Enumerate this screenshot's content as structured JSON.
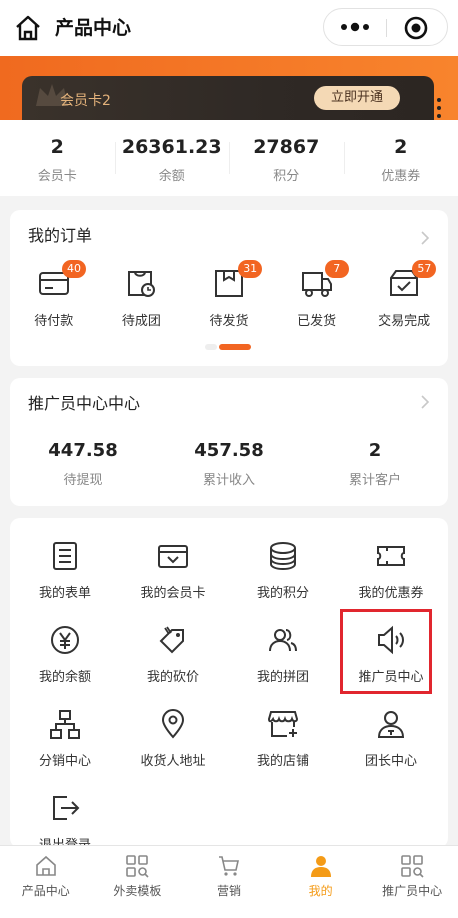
{
  "header": {
    "title": "产品中心"
  },
  "vip": {
    "label": "会员卡2",
    "button": "立即开通"
  },
  "stats": [
    {
      "value": "2",
      "label": "会员卡"
    },
    {
      "value": "26361.23",
      "label": "余额"
    },
    {
      "value": "27867",
      "label": "积分"
    },
    {
      "value": "2",
      "label": "优惠券"
    }
  ],
  "orders": {
    "title": "我的订单",
    "items": [
      {
        "label": "待付款",
        "badge": "40",
        "icon": "wallet-icon"
      },
      {
        "label": "待成团",
        "badge": "",
        "icon": "group-clock-icon"
      },
      {
        "label": "待发货",
        "badge": "31",
        "icon": "box-icon"
      },
      {
        "label": "已发货",
        "badge": "7",
        "icon": "truck-icon"
      },
      {
        "label": "交易完成",
        "badge": "57",
        "icon": "check-box-icon"
      }
    ]
  },
  "promoter": {
    "title": "推广员中心中心",
    "items": [
      {
        "value": "447.58",
        "label": "待提现"
      },
      {
        "value": "457.58",
        "label": "累计收入"
      },
      {
        "value": "2",
        "label": "累计客户"
      }
    ]
  },
  "tools": [
    {
      "label": "我的表单",
      "icon": "form-icon"
    },
    {
      "label": "我的会员卡",
      "icon": "member-card-icon"
    },
    {
      "label": "我的积分",
      "icon": "points-icon"
    },
    {
      "label": "我的优惠券",
      "icon": "coupon-icon"
    },
    {
      "label": "我的余额",
      "icon": "yen-icon"
    },
    {
      "label": "我的砍价",
      "icon": "bargain-tag-icon"
    },
    {
      "label": "我的拼团",
      "icon": "group-icon"
    },
    {
      "label": "推广员中心",
      "icon": "speaker-icon"
    },
    {
      "label": "分销中心",
      "icon": "hierarchy-icon"
    },
    {
      "label": "收货人地址",
      "icon": "location-icon"
    },
    {
      "label": "我的店铺",
      "icon": "store-icon"
    },
    {
      "label": "团长中心",
      "icon": "leader-icon"
    },
    {
      "label": "退出登录",
      "icon": "logout-icon"
    }
  ],
  "tabbar": [
    {
      "label": "产品中心",
      "icon": "home-icon",
      "active": false
    },
    {
      "label": "外卖模板",
      "icon": "grid-search-icon",
      "active": false
    },
    {
      "label": "营销",
      "icon": "cart-icon",
      "active": false
    },
    {
      "label": "我的",
      "icon": "user-icon",
      "active": true
    },
    {
      "label": "推广员中心",
      "icon": "grid-search-icon",
      "active": false
    }
  ],
  "colors": {
    "accent": "#f26522",
    "active_tab": "#f49b17",
    "highlight": "#e1262e"
  }
}
